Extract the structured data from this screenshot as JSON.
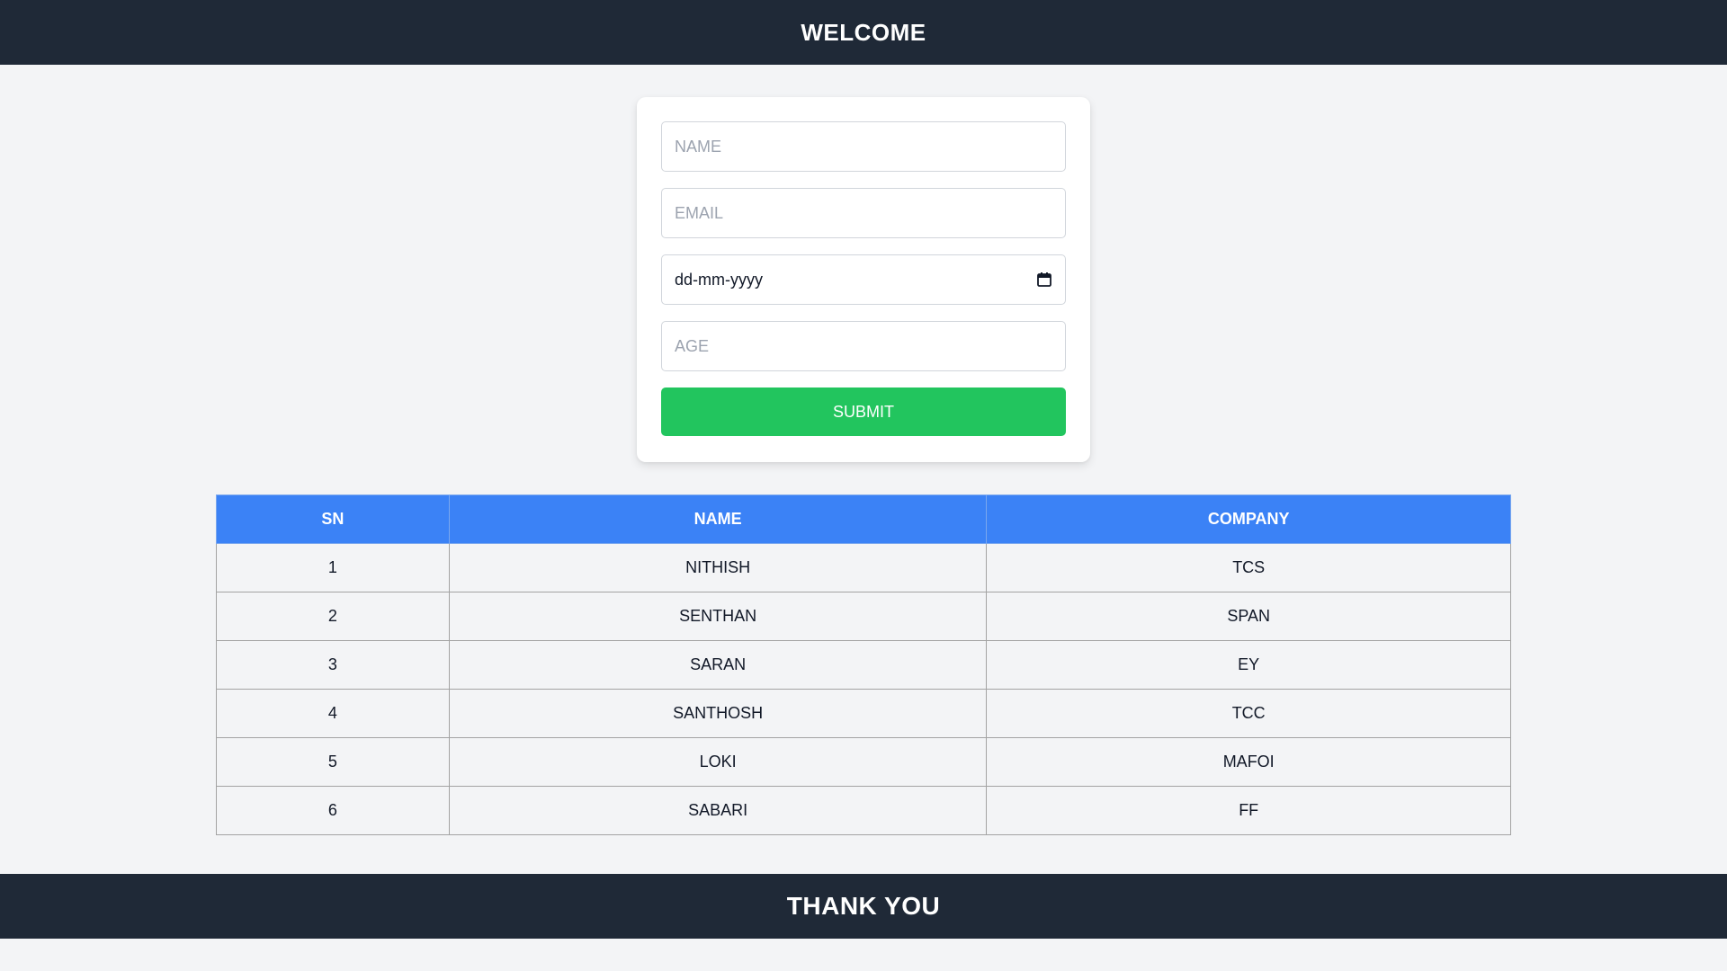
{
  "header": {
    "title": "WELCOME"
  },
  "form": {
    "name_placeholder": "NAME",
    "email_placeholder": "EMAIL",
    "date_placeholder": "dd-mm-yyyy",
    "age_placeholder": "AGE",
    "submit_label": "SUBMIT"
  },
  "table": {
    "headers": [
      "SN",
      "NAME",
      "COMPANY"
    ],
    "rows": [
      [
        "1",
        "NITHISH",
        "TCS"
      ],
      [
        "2",
        "SENTHAN",
        "SPAN"
      ],
      [
        "3",
        "SARAN",
        "EY"
      ],
      [
        "4",
        "SANTHOSH",
        "TCC"
      ],
      [
        "5",
        "LOKI",
        "MAFOI"
      ],
      [
        "6",
        "SABARI",
        "FF"
      ]
    ]
  },
  "footer": {
    "title": "THANK YOU"
  },
  "colors": {
    "header_bg": "#1f2937",
    "page_bg": "#f3f4f6",
    "submit_bg": "#22c55e",
    "table_header_bg": "#3b82f6"
  },
  "icons": {
    "date_picker": "calendar-icon"
  }
}
